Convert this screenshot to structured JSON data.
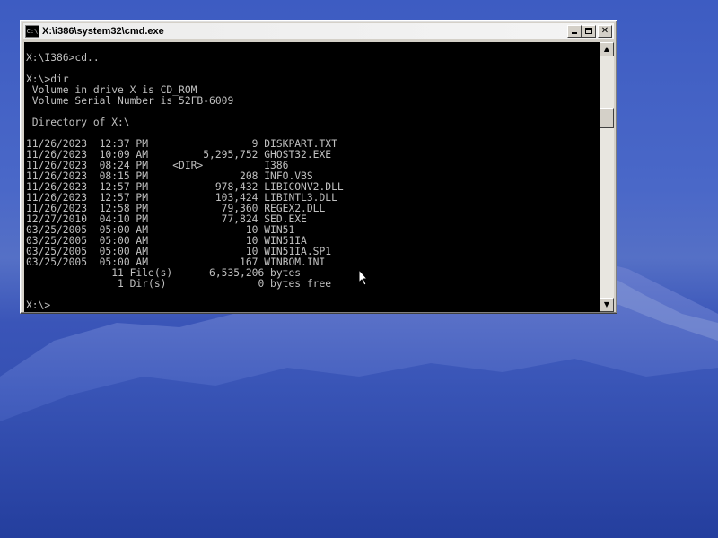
{
  "window": {
    "title": "X:\\i386\\system32\\cmd.exe",
    "icon_label": "C:\\"
  },
  "console": {
    "lines": [
      "",
      "X:\\I386>cd..",
      "",
      "X:\\>dir",
      " Volume in drive X is CD_ROM",
      " Volume Serial Number is 52FB-6009",
      "",
      " Directory of X:\\",
      "",
      "11/26/2023  12:37 PM                 9 DISKPART.TXT",
      "11/26/2023  10:09 AM         5,295,752 GHOST32.EXE",
      "11/26/2023  08:24 PM    <DIR>          I386",
      "11/26/2023  08:15 PM               208 INFO.VBS",
      "11/26/2023  12:57 PM           978,432 LIBICONV2.DLL",
      "11/26/2023  12:57 PM           103,424 LIBINTL3.DLL",
      "11/26/2023  12:58 PM            79,360 REGEX2.DLL",
      "12/27/2010  04:10 PM            77,824 SED.EXE",
      "03/25/2005  05:00 AM                10 WIN51",
      "03/25/2005  05:00 AM                10 WIN51IA",
      "03/25/2005  05:00 AM                10 WIN51IA.SP1",
      "03/25/2005  05:00 AM               167 WINBOM.INI",
      "              11 File(s)      6,535,206 bytes",
      "               1 Dir(s)               0 bytes free",
      "",
      "X:\\>"
    ]
  },
  "icons": {
    "minimize": "minimize-icon",
    "maximize": "maximize-icon",
    "close": "close-icon",
    "scroll_up": "arrow-up-icon",
    "scroll_down": "arrow-down-icon",
    "cursor": "mouse-pointer-icon"
  },
  "colors": {
    "console_bg": "#000000",
    "console_fg": "#c0c0c0",
    "desktop_sky": "#3d5cc2"
  }
}
